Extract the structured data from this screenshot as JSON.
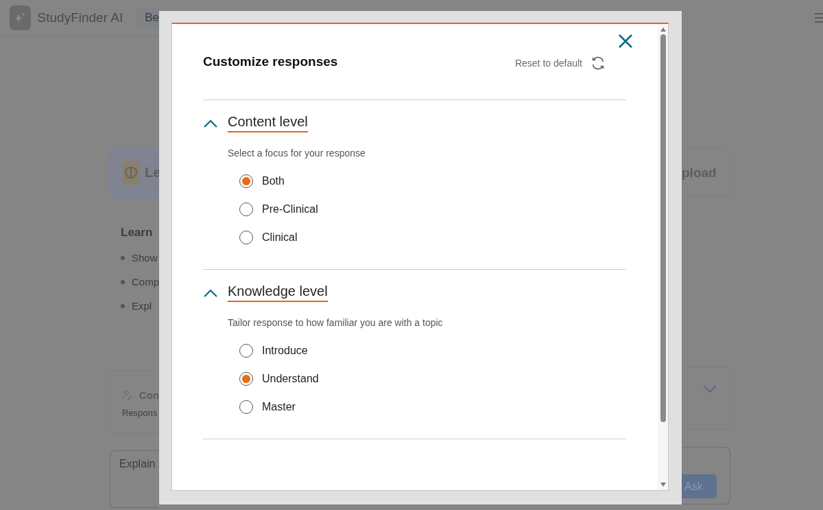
{
  "app": {
    "name": "StudyFinder AI",
    "badge": "Be"
  },
  "background": {
    "mode_card": {
      "label": "Le"
    },
    "upload_card": {
      "label": "pload"
    },
    "learn": {
      "heading": "Learn",
      "bullets": [
        "Show",
        "Comp",
        "Expl"
      ]
    },
    "control_card": {
      "title": "Con",
      "subtitle": "Respons"
    },
    "question": {
      "placeholder": "Explain",
      "button": "Ask"
    }
  },
  "dialog": {
    "title": "Customize responses",
    "reset": "Reset to default",
    "sections": [
      {
        "title": "Content level",
        "expanded": true,
        "description": "Select a focus for your response",
        "options": [
          {
            "label": "Both",
            "selected": true
          },
          {
            "label": "Pre-Clinical",
            "selected": false
          },
          {
            "label": "Clinical",
            "selected": false
          }
        ]
      },
      {
        "title": "Knowledge level",
        "expanded": true,
        "description": "Tailor response to how familiar you are with a topic",
        "options": [
          {
            "label": "Introduce",
            "selected": false
          },
          {
            "label": "Understand",
            "selected": true
          },
          {
            "label": "Master",
            "selected": false
          }
        ]
      }
    ]
  }
}
